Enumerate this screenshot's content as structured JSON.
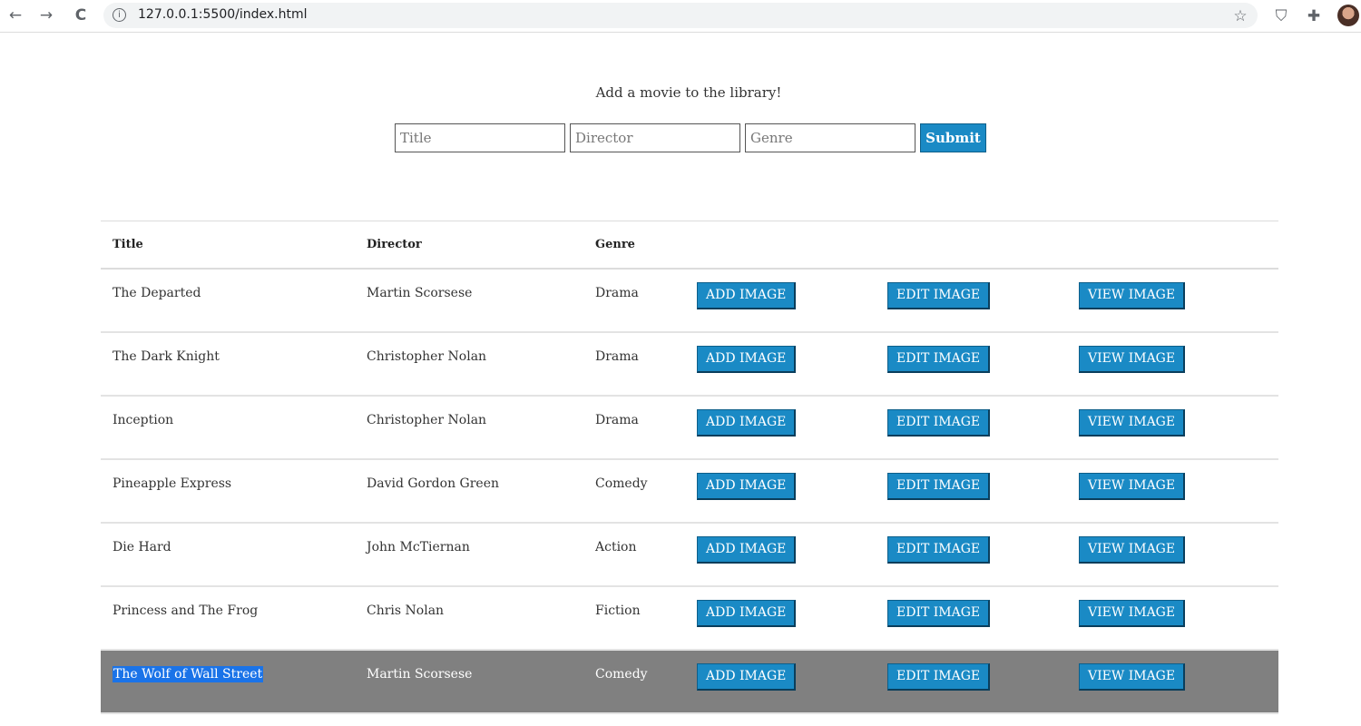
{
  "browser": {
    "back_icon": "←",
    "forward_icon": "→",
    "reload_icon": "C",
    "info_icon": "i",
    "url": "127.0.0.1:5500/index.html",
    "star_icon": "☆",
    "shield_icon": "⛉",
    "puzzle_icon": "✚"
  },
  "form": {
    "heading": "Add a movie to the library!",
    "title_placeholder": "Title",
    "director_placeholder": "Director",
    "genre_placeholder": "Genre",
    "submit_label": "Submit"
  },
  "table": {
    "headers": {
      "title": "Title",
      "director": "Director",
      "genre": "Genre"
    },
    "add_label": "ADD IMAGE",
    "edit_label": "EDIT IMAGE",
    "view_label": "VIEW IMAGE",
    "rows": [
      {
        "title": "The Departed",
        "director": "Martin Scorsese",
        "genre": "Drama"
      },
      {
        "title": "The Dark Knight",
        "director": "Christopher Nolan",
        "genre": "Drama"
      },
      {
        "title": "Inception",
        "director": "Christopher Nolan",
        "genre": "Drama"
      },
      {
        "title": "Pineapple Express",
        "director": "David Gordon Green",
        "genre": "Comedy"
      },
      {
        "title": "Die Hard",
        "director": "John McTiernan",
        "genre": "Action"
      },
      {
        "title": "Princess and The Frog",
        "director": "Chris Nolan",
        "genre": "Fiction"
      },
      {
        "title": "The Wolf of Wall Street",
        "director": "Martin Scorsese",
        "genre": "Comedy"
      }
    ]
  },
  "colors": {
    "accent": "#1a8ac5",
    "selected_row": "#808080",
    "text_highlight": "#1a73e8"
  }
}
